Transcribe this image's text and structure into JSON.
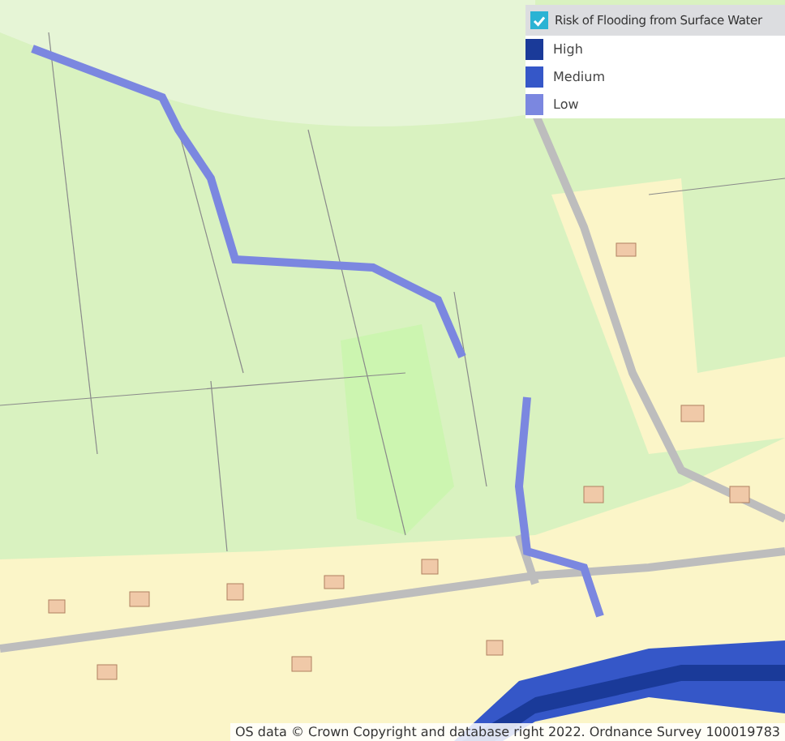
{
  "legend": {
    "layer": {
      "label": "Risk of Flooding from Surface Water",
      "checked": true
    },
    "items": [
      {
        "label": "High",
        "color": "#1a3a99"
      },
      {
        "label": "Medium",
        "color": "#3557c8"
      },
      {
        "label": "Low",
        "color": "#7b87e0"
      }
    ]
  },
  "attribution": "OS data © Crown Copyright and database right 2022. Ordnance Survey 100019783"
}
